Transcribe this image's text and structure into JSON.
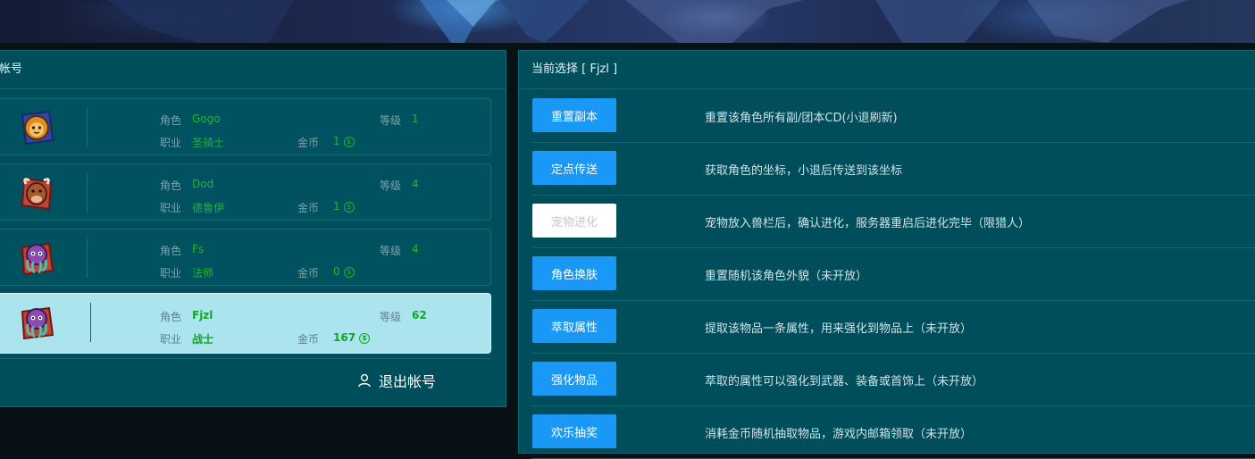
{
  "left_panel": {
    "title": "帐号",
    "labels": {
      "role": "角色",
      "class": "职业",
      "level": "等级",
      "gold": "金币"
    },
    "characters": [
      {
        "name": "Gogo",
        "class": "圣骑士",
        "level": "1",
        "gold": "1",
        "avatar": "lion-avatar-icon",
        "selected": false
      },
      {
        "name": "Dod",
        "class": "德鲁伊",
        "level": "4",
        "gold": "1",
        "avatar": "bull-avatar-icon",
        "selected": false
      },
      {
        "name": "Fs",
        "class": "法师",
        "level": "4",
        "gold": "0",
        "avatar": "octopus-avatar-icon",
        "selected": false
      },
      {
        "name": "Fjzl",
        "class": "战士",
        "level": "62",
        "gold": "167",
        "avatar": "octopus-avatar-icon",
        "selected": true
      }
    ],
    "logout_label": "退出帐号"
  },
  "right_panel": {
    "title": "当前选择 [ Fjzl ]",
    "actions": [
      {
        "label": "重置副本",
        "desc": "重置该角色所有副/团本CD(小退刷新)",
        "disabled": false
      },
      {
        "label": "定点传送",
        "desc": "获取角色的坐标，小退后传送到该坐标",
        "disabled": false
      },
      {
        "label": "宠物进化",
        "desc": "宠物放入兽栏后，确认进化，服务器重启后进化完毕（限猎人）",
        "disabled": true
      },
      {
        "label": "角色换肤",
        "desc": "重置随机该角色外貌（未开放）",
        "disabled": false
      },
      {
        "label": "萃取属性",
        "desc": "提取该物品一条属性，用来强化到物品上（未开放）",
        "disabled": false
      },
      {
        "label": "强化物品",
        "desc": "萃取的属性可以强化到武器、装备或首饰上（未开放）",
        "disabled": false
      },
      {
        "label": "欢乐抽奖",
        "desc": "消耗金币随机抽取物品，游戏内邮箱领取（未开放）",
        "disabled": false
      }
    ]
  },
  "colors": {
    "panel_bg": "#004e5b",
    "button_blue": "#1a98f5",
    "value_green": "#21b531",
    "selected_bg": "#abe3ef"
  }
}
